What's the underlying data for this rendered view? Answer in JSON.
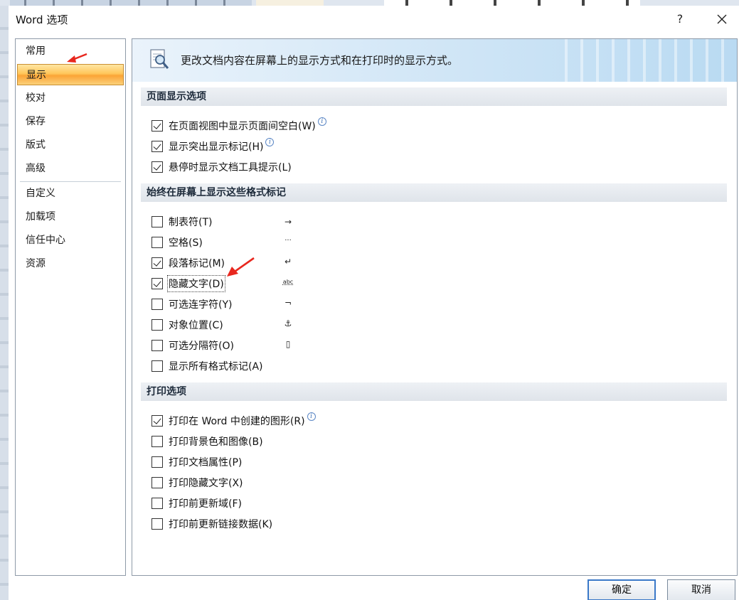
{
  "window": {
    "title": "Word 选项",
    "help_label": "?",
    "close_label": "✕"
  },
  "nav": {
    "items": [
      {
        "label": "常用",
        "active": false
      },
      {
        "label": "显示",
        "active": true
      },
      {
        "label": "校对",
        "active": false
      },
      {
        "label": "保存",
        "active": false
      },
      {
        "label": "版式",
        "active": false
      },
      {
        "label": "高级",
        "active": false
      },
      {
        "label": "自定义",
        "active": false
      },
      {
        "label": "加载项",
        "active": false
      },
      {
        "label": "信任中心",
        "active": false
      },
      {
        "label": "资源",
        "active": false
      }
    ]
  },
  "banner": {
    "icon": "magnifier-document-icon",
    "text": "更改文档内容在屏幕上的显示方式和在打印时的显示方式。"
  },
  "sections": {
    "page_display": {
      "title": "页面显示选项",
      "options": [
        {
          "label": "在页面视图中显示页面间空白(W)",
          "checked": true,
          "info": true
        },
        {
          "label": "显示突出显示标记(H)",
          "checked": true,
          "info": true
        },
        {
          "label": "悬停时显示文档工具提示(L)",
          "checked": true,
          "info": false
        }
      ]
    },
    "format_marks": {
      "title": "始终在屏幕上显示这些格式标记",
      "options": [
        {
          "label": "制表符(T)",
          "checked": false,
          "symbol": "→"
        },
        {
          "label": "空格(S)",
          "checked": false,
          "symbol": "···"
        },
        {
          "label": "段落标记(M)",
          "checked": true,
          "symbol": "↵"
        },
        {
          "label": "隐藏文字(D)",
          "checked": true,
          "symbol": "abc"
        },
        {
          "label": "可选连字符(Y)",
          "checked": false,
          "symbol": "¬"
        },
        {
          "label": "对象位置(C)",
          "checked": false,
          "symbol": "⚓"
        },
        {
          "label": "可选分隔符(O)",
          "checked": false,
          "symbol": "▯"
        },
        {
          "label": "显示所有格式标记(A)",
          "checked": false,
          "symbol": ""
        }
      ]
    },
    "print": {
      "title": "打印选项",
      "options": [
        {
          "label": "打印在 Word 中创建的图形(R)",
          "checked": true,
          "info": true
        },
        {
          "label": "打印背景色和图像(B)",
          "checked": false,
          "info": false
        },
        {
          "label": "打印文档属性(P)",
          "checked": false,
          "info": false
        },
        {
          "label": "打印隐藏文字(X)",
          "checked": false,
          "info": false
        },
        {
          "label": "打印前更新域(F)",
          "checked": false,
          "info": false
        },
        {
          "label": "打印前更新链接数据(K)",
          "checked": false,
          "info": false
        }
      ]
    }
  },
  "buttons": {
    "ok_label": "确定",
    "cancel_label": "取消"
  },
  "colors": {
    "active_nav": "#fba436",
    "annotation_arrow": "#e8271e",
    "banner": "#cfe5f6"
  }
}
